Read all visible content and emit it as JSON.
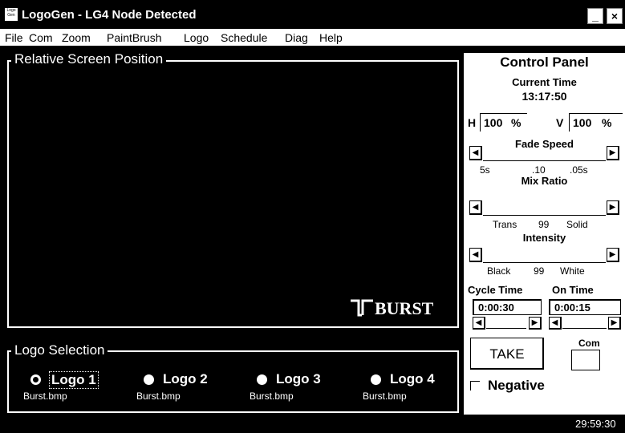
{
  "window": {
    "title": "LogoGen - LG4 Node Detected",
    "icon_text": "Logo Gen",
    "minimize": "_",
    "close": "×"
  },
  "menu": [
    "File",
    "Com",
    "Zoom",
    "PaintBrush",
    "Logo",
    "Schedule",
    "Diag",
    "Help"
  ],
  "preview": {
    "title": "Relative Screen Position",
    "logo_text": "BURST"
  },
  "logo_selection": {
    "title": "Logo Selection",
    "logos": [
      {
        "label": "Logo 1",
        "file": "Burst.bmp",
        "selected": true
      },
      {
        "label": "Logo 2",
        "file": "Burst.bmp",
        "selected": false
      },
      {
        "label": "Logo 3",
        "file": "Burst.bmp",
        "selected": false
      },
      {
        "label": "Logo 4",
        "file": "Burst.bmp",
        "selected": false
      }
    ]
  },
  "control_panel": {
    "title": "Control Panel",
    "current_time_label": "Current Time",
    "current_time": "13:17:50",
    "h_label": "H",
    "h_value": "100",
    "v_label": "V",
    "v_value": "100",
    "percent": "%",
    "fade_speed": {
      "label": "Fade Speed",
      "left": "5s",
      "mid": ".10",
      "right": ".05s"
    },
    "mix_ratio": {
      "label": "Mix Ratio",
      "left": "Trans",
      "mid": "99",
      "right": "Solid"
    },
    "intensity": {
      "label": "Intensity",
      "left": "Black",
      "mid": "99",
      "right": "White"
    },
    "cycle_time_label": "Cycle Time",
    "cycle_time": "0:00:30",
    "on_time_label": "On Time",
    "on_time": "0:00:15",
    "take_label": "TAKE",
    "com_label": "Com",
    "negative_label": "Negative",
    "negative_checked": false
  },
  "status": {
    "time": "29:59:30"
  }
}
